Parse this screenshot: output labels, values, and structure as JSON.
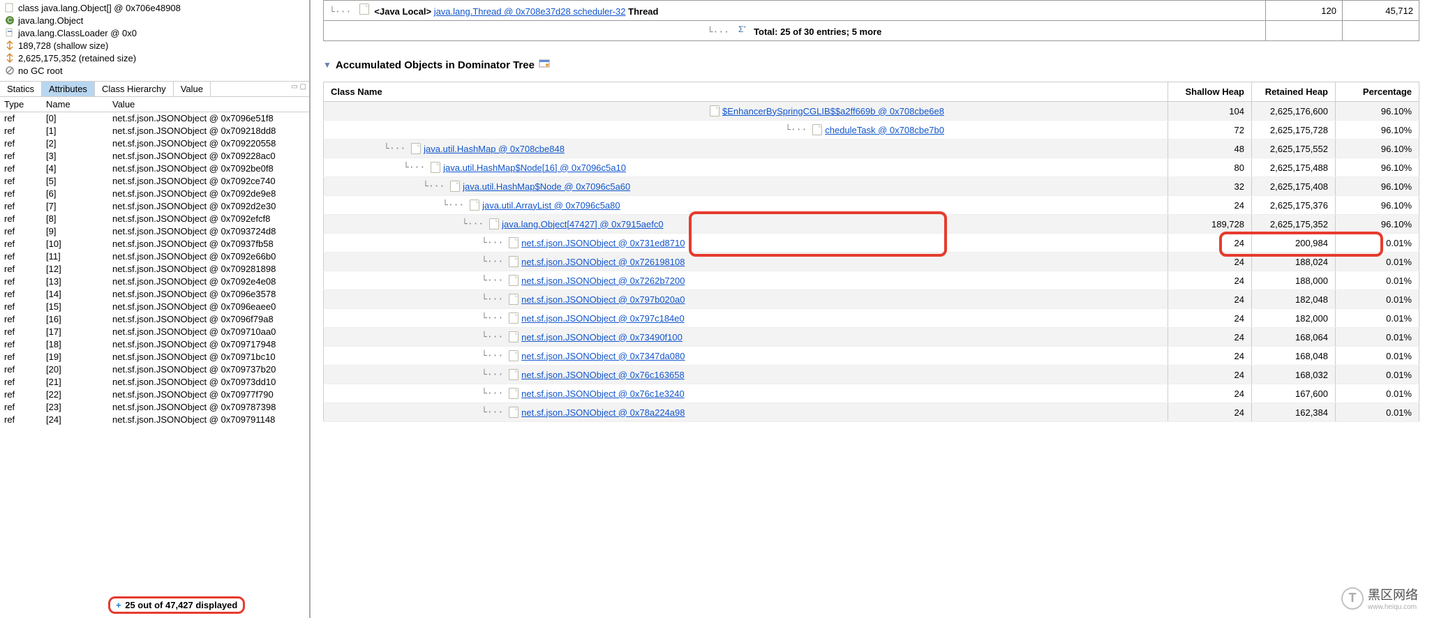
{
  "left": {
    "header": {
      "class_label": "class java.lang.Object[] @ 0x706e48908",
      "super_label": "java.lang.Object",
      "classloader_label": "java.lang.ClassLoader @ 0x0",
      "shallow_label": "189,728 (shallow size)",
      "retained_label": "2,625,175,352 (retained size)",
      "gcroot_label": "no GC root"
    },
    "tabs": [
      "Statics",
      "Attributes",
      "Class Hierarchy",
      "Value"
    ],
    "active_tab": 1,
    "columns": {
      "type": "Type",
      "name": "Name",
      "value": "Value"
    },
    "rows": [
      {
        "type": "ref",
        "name": "[0]",
        "value": "net.sf.json.JSONObject @ 0x7096e51f8"
      },
      {
        "type": "ref",
        "name": "[1]",
        "value": "net.sf.json.JSONObject @ 0x709218dd8"
      },
      {
        "type": "ref",
        "name": "[2]",
        "value": "net.sf.json.JSONObject @ 0x709220558"
      },
      {
        "type": "ref",
        "name": "[3]",
        "value": "net.sf.json.JSONObject @ 0x709228ac0"
      },
      {
        "type": "ref",
        "name": "[4]",
        "value": "net.sf.json.JSONObject @ 0x7092be0f8"
      },
      {
        "type": "ref",
        "name": "[5]",
        "value": "net.sf.json.JSONObject @ 0x7092ce740"
      },
      {
        "type": "ref",
        "name": "[6]",
        "value": "net.sf.json.JSONObject @ 0x7092de9e8"
      },
      {
        "type": "ref",
        "name": "[7]",
        "value": "net.sf.json.JSONObject @ 0x7092d2e30"
      },
      {
        "type": "ref",
        "name": "[8]",
        "value": "net.sf.json.JSONObject @ 0x7092efcf8"
      },
      {
        "type": "ref",
        "name": "[9]",
        "value": "net.sf.json.JSONObject @ 0x7093724d8"
      },
      {
        "type": "ref",
        "name": "[10]",
        "value": "net.sf.json.JSONObject @ 0x70937fb58"
      },
      {
        "type": "ref",
        "name": "[11]",
        "value": "net.sf.json.JSONObject @ 0x7092e66b0"
      },
      {
        "type": "ref",
        "name": "[12]",
        "value": "net.sf.json.JSONObject @ 0x709281898"
      },
      {
        "type": "ref",
        "name": "[13]",
        "value": "net.sf.json.JSONObject @ 0x7092e4e08"
      },
      {
        "type": "ref",
        "name": "[14]",
        "value": "net.sf.json.JSONObject @ 0x7096e3578"
      },
      {
        "type": "ref",
        "name": "[15]",
        "value": "net.sf.json.JSONObject @ 0x7096eaee0"
      },
      {
        "type": "ref",
        "name": "[16]",
        "value": "net.sf.json.JSONObject @ 0x7096f79a8"
      },
      {
        "type": "ref",
        "name": "[17]",
        "value": "net.sf.json.JSONObject @ 0x709710aa0"
      },
      {
        "type": "ref",
        "name": "[18]",
        "value": "net.sf.json.JSONObject @ 0x709717948"
      },
      {
        "type": "ref",
        "name": "[19]",
        "value": "net.sf.json.JSONObject @ 0x70971bc10"
      },
      {
        "type": "ref",
        "name": "[20]",
        "value": "net.sf.json.JSONObject @ 0x709737b20"
      },
      {
        "type": "ref",
        "name": "[21]",
        "value": "net.sf.json.JSONObject @ 0x70973dd10"
      },
      {
        "type": "ref",
        "name": "[22]",
        "value": "net.sf.json.JSONObject @ 0x70977f790"
      },
      {
        "type": "ref",
        "name": "[23]",
        "value": "net.sf.json.JSONObject @ 0x709787398"
      },
      {
        "type": "ref",
        "name": "[24]",
        "value": "net.sf.json.JSONObject @ 0x709791148"
      }
    ],
    "footer": "25 out of 47,427 displayed"
  },
  "right": {
    "top_rows": [
      {
        "prefix": "<Java Local>",
        "link": "java.lang.Thread @ 0x708e37d28 scheduler-32",
        "suffix": " Thread",
        "shallow": "120",
        "retained": "45,712"
      },
      {
        "total": "Total: 25 of 30 entries; 5 more"
      }
    ],
    "section_title": "Accumulated Objects in Dominator Tree",
    "columns": {
      "name": "Class Name",
      "shallow": "Shallow Heap",
      "retained": "Retained Heap",
      "pct": "Percentage"
    },
    "rows": [
      {
        "indent": 0,
        "name": "$EnhancerBySpringCGLIB$$a2ff669b @ 0x708cbe6e8",
        "align": "right",
        "shallow": "104",
        "retained": "2,625,176,600",
        "pct": "96.10%"
      },
      {
        "indent": 1,
        "name": "cheduleTask @ 0x708cbe7b0",
        "align": "right",
        "shallow": "72",
        "retained": "2,625,175,728",
        "pct": "96.10%"
      },
      {
        "indent": 2,
        "name": "java.util.HashMap @ 0x708cbe848",
        "shallow": "48",
        "retained": "2,625,175,552",
        "pct": "96.10%"
      },
      {
        "indent": 3,
        "name": "java.util.HashMap$Node[16] @ 0x7096c5a10",
        "shallow": "80",
        "retained": "2,625,175,488",
        "pct": "96.10%"
      },
      {
        "indent": 4,
        "name": "java.util.HashMap$Node @ 0x7096c5a60",
        "shallow": "32",
        "retained": "2,625,175,408",
        "pct": "96.10%"
      },
      {
        "indent": 5,
        "name": "java.util.ArrayList @ 0x7096c5a80",
        "shallow": "24",
        "retained": "2,625,175,376",
        "pct": "96.10%"
      },
      {
        "indent": 6,
        "name": "java.lang.Object[47427] @ 0x7915aefc0",
        "shallow": "189,728",
        "retained": "2,625,175,352",
        "pct": "96.10%"
      },
      {
        "indent": 7,
        "name": "net.sf.json.JSONObject @ 0x731ed8710",
        "shallow": "24",
        "retained": "200,984",
        "pct": "0.01%"
      },
      {
        "indent": 7,
        "name": "net.sf.json.JSONObject @ 0x726198108",
        "shallow": "24",
        "retained": "188,024",
        "pct": "0.01%"
      },
      {
        "indent": 7,
        "name": "net.sf.json.JSONObject @ 0x7262b7200",
        "shallow": "24",
        "retained": "188,000",
        "pct": "0.01%"
      },
      {
        "indent": 7,
        "name": "net.sf.json.JSONObject @ 0x797b020a0",
        "shallow": "24",
        "retained": "182,048",
        "pct": "0.01%"
      },
      {
        "indent": 7,
        "name": "net.sf.json.JSONObject @ 0x797c184e0",
        "shallow": "24",
        "retained": "182,000",
        "pct": "0.01%"
      },
      {
        "indent": 7,
        "name": "net.sf.json.JSONObject @ 0x73490f100",
        "shallow": "24",
        "retained": "168,064",
        "pct": "0.01%"
      },
      {
        "indent": 7,
        "name": "net.sf.json.JSONObject @ 0x7347da080",
        "shallow": "24",
        "retained": "168,048",
        "pct": "0.01%"
      },
      {
        "indent": 7,
        "name": "net.sf.json.JSONObject @ 0x76c163658",
        "shallow": "24",
        "retained": "168,032",
        "pct": "0.01%"
      },
      {
        "indent": 7,
        "name": "net.sf.json.JSONObject @ 0x76c1e3240",
        "shallow": "24",
        "retained": "167,600",
        "pct": "0.01%"
      },
      {
        "indent": 7,
        "name": "net.sf.json.JSONObject @ 0x78a224a98",
        "shallow": "24",
        "retained": "162,384",
        "pct": "0.01%"
      }
    ]
  },
  "watermark": {
    "text": "黑区网络",
    "sub": "www.heiqu.com"
  }
}
